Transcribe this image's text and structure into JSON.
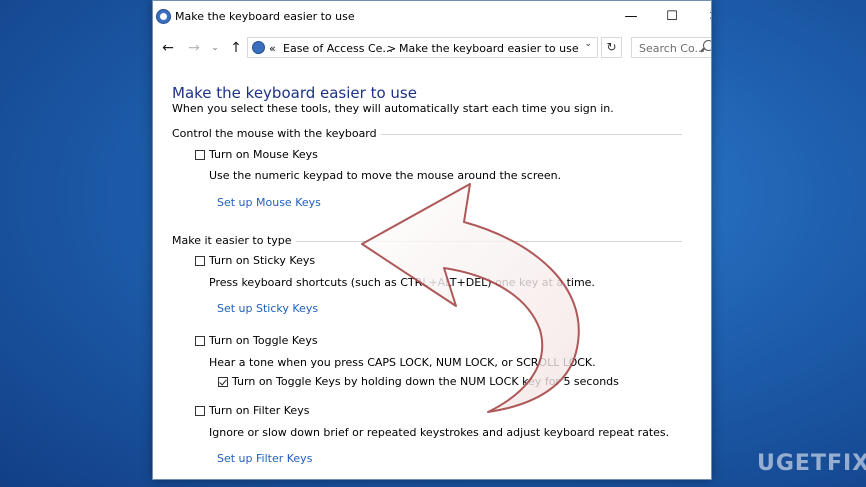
{
  "window": {
    "title": "Make the keyboard easier to use",
    "controls": {
      "minimize": "—",
      "maximize": "☐",
      "close": "✕"
    }
  },
  "nav": {
    "back": "←",
    "forward": "→",
    "recent": "⌄",
    "up": "↑",
    "address": {
      "prefix": "«",
      "crumb1": "Ease of Access Ce...",
      "sep": ">",
      "crumb2": "Make the keyboard easier to use",
      "dropdown": "⌄"
    },
    "refresh": "↻",
    "search_placeholder": "Search Co..."
  },
  "page": {
    "heading": "Make the keyboard easier to use",
    "subheading": "When you select these tools, they will automatically start each time you sign in."
  },
  "mouse_section": {
    "title": "Control the mouse with the keyboard",
    "mouse_keys": {
      "label": "Turn on Mouse Keys",
      "checked": false,
      "description": "Use the numeric keypad to move the mouse around the screen.",
      "link": "Set up Mouse Keys"
    }
  },
  "type_section": {
    "title": "Make it easier to type",
    "sticky_keys": {
      "label": "Turn on Sticky Keys",
      "checked": false,
      "description": "Press keyboard shortcuts (such as CTRL+ALT+DEL) one key at a time.",
      "link": "Set up Sticky Keys"
    },
    "toggle_keys": {
      "label": "Turn on Toggle Keys",
      "checked": false,
      "description": "Hear a tone when you press CAPS LOCK, NUM LOCK, or SCROLL LOCK.",
      "sub_option": {
        "label": "Turn on Toggle Keys by holding down the NUM LOCK key for 5 seconds",
        "checked": true
      }
    },
    "filter_keys": {
      "label": "Turn on Filter Keys",
      "checked": false,
      "description": "Ignore or slow down brief or repeated keystrokes and adjust keyboard repeat rates.",
      "link": "Set up Filter Keys"
    }
  },
  "watermark": "UGETFIX"
}
